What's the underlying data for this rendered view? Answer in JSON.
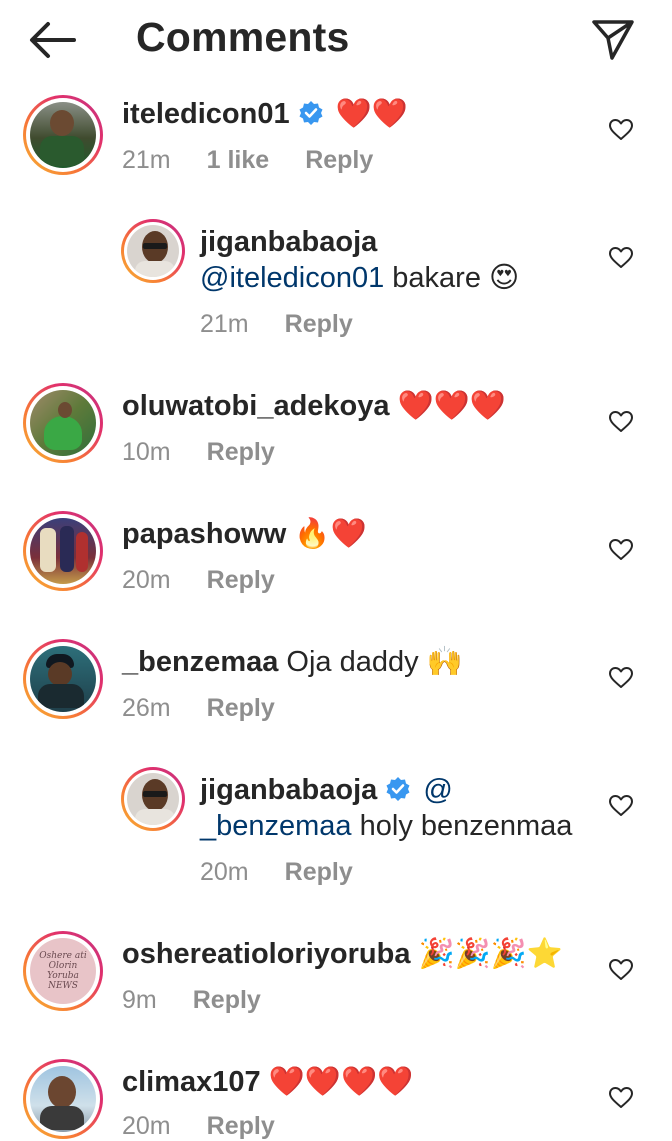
{
  "header": {
    "title": "Comments"
  },
  "comments": [
    {
      "username": "iteledicon01",
      "verified": true,
      "text": "❤️❤️",
      "time": "21m",
      "likes": "1 like",
      "reply": "Reply"
    },
    {
      "username": "jiganbabaoja",
      "verified": false,
      "mention": "@iteledicon01",
      "text": " bakare 😍",
      "time": "21m",
      "reply": "Reply"
    },
    {
      "username": "oluwatobi_adekoya",
      "verified": false,
      "text": "❤️❤️❤️",
      "time": "10m",
      "reply": "Reply"
    },
    {
      "username": "papashoww",
      "verified": false,
      "text": "🔥❤️",
      "time": "20m",
      "reply": "Reply"
    },
    {
      "username": "_benzemaa",
      "verified": false,
      "text": "Oja daddy 🙌",
      "time": "26m",
      "reply": "Reply"
    },
    {
      "username": "jiganbabaoja",
      "verified": true,
      "mention_part1": "@",
      "mention_part2": "_benzemaa",
      "text": " holy benzenmaa",
      "time": "20m",
      "reply": "Reply"
    },
    {
      "username": "oshereatioloriyoruba",
      "verified": false,
      "text": "🎉🎉🎉⭐",
      "time": "9m",
      "reply": "Reply",
      "avatar_text": "Oshere ati Olorin Yoruba NEWS"
    },
    {
      "username": "climax107",
      "verified": false,
      "text": "❤️❤️❤️❤️",
      "time": "20m",
      "reply": "Reply"
    }
  ],
  "colors": {
    "mention": "#00376b",
    "verified": "#3897f0",
    "meta": "#8e8e8e"
  }
}
